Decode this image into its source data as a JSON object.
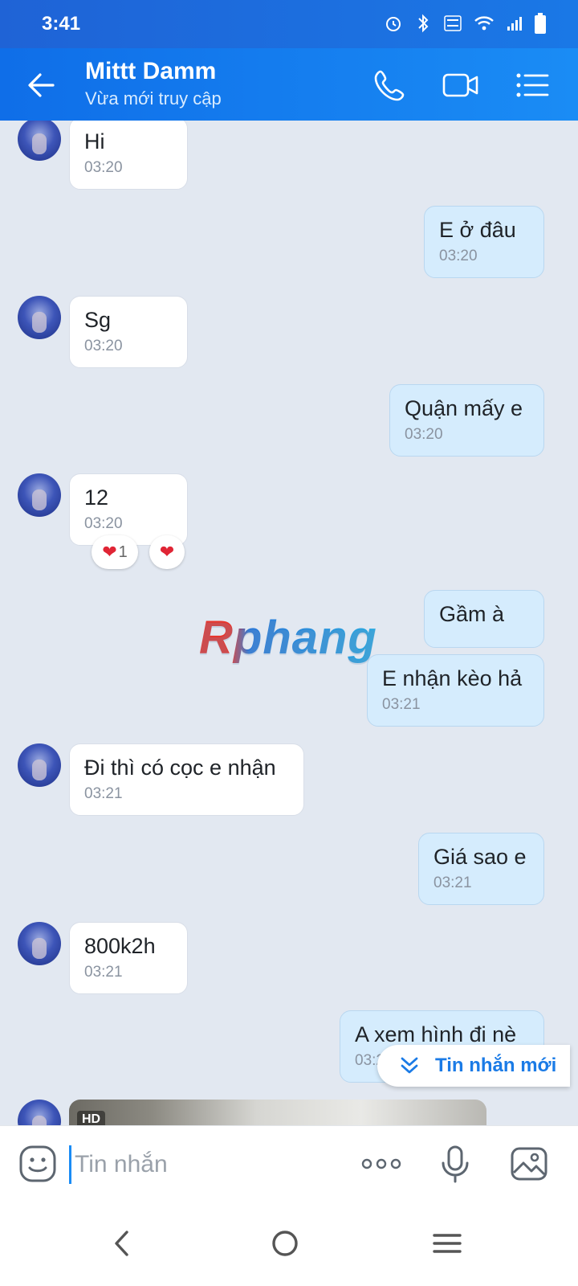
{
  "status_bar": {
    "time": "3:41"
  },
  "header": {
    "contact_name": "Mittt Damm",
    "contact_status": "Vừa mới truy cập"
  },
  "messages": [
    {
      "dir": "in",
      "text": "Hi",
      "time": "03:20"
    },
    {
      "dir": "out",
      "text": "E ở đâu",
      "time": "03:20"
    },
    {
      "dir": "in",
      "text": "Sg",
      "time": "03:20"
    },
    {
      "dir": "out",
      "text": "Quận mấy e",
      "time": "03:20"
    },
    {
      "dir": "in",
      "text": "12",
      "time": "03:20",
      "reaction_count": "1"
    },
    {
      "dir": "out",
      "text": "Gầm à",
      "time": ""
    },
    {
      "dir": "out",
      "text": "E nhận kèo hả",
      "time": "03:21"
    },
    {
      "dir": "in",
      "text": "Đi thì có cọc e nhận",
      "time": "03:21"
    },
    {
      "dir": "out",
      "text": "Giá sao e",
      "time": "03:21"
    },
    {
      "dir": "in",
      "text": "800k2h",
      "time": "03:21"
    },
    {
      "dir": "out",
      "text": "A xem hình đi nè",
      "time": "03:21"
    }
  ],
  "watermark": "Rphang",
  "new_message_banner": "Tin nhắn mới",
  "media": {
    "badge": "HD"
  },
  "input": {
    "placeholder": "Tin nhắn"
  },
  "colors": {
    "header": "#1a8cf5",
    "outgoing_bubble": "#d5ecfd",
    "incoming_bubble": "#ffffff",
    "chat_bg": "#e2e8f1"
  }
}
